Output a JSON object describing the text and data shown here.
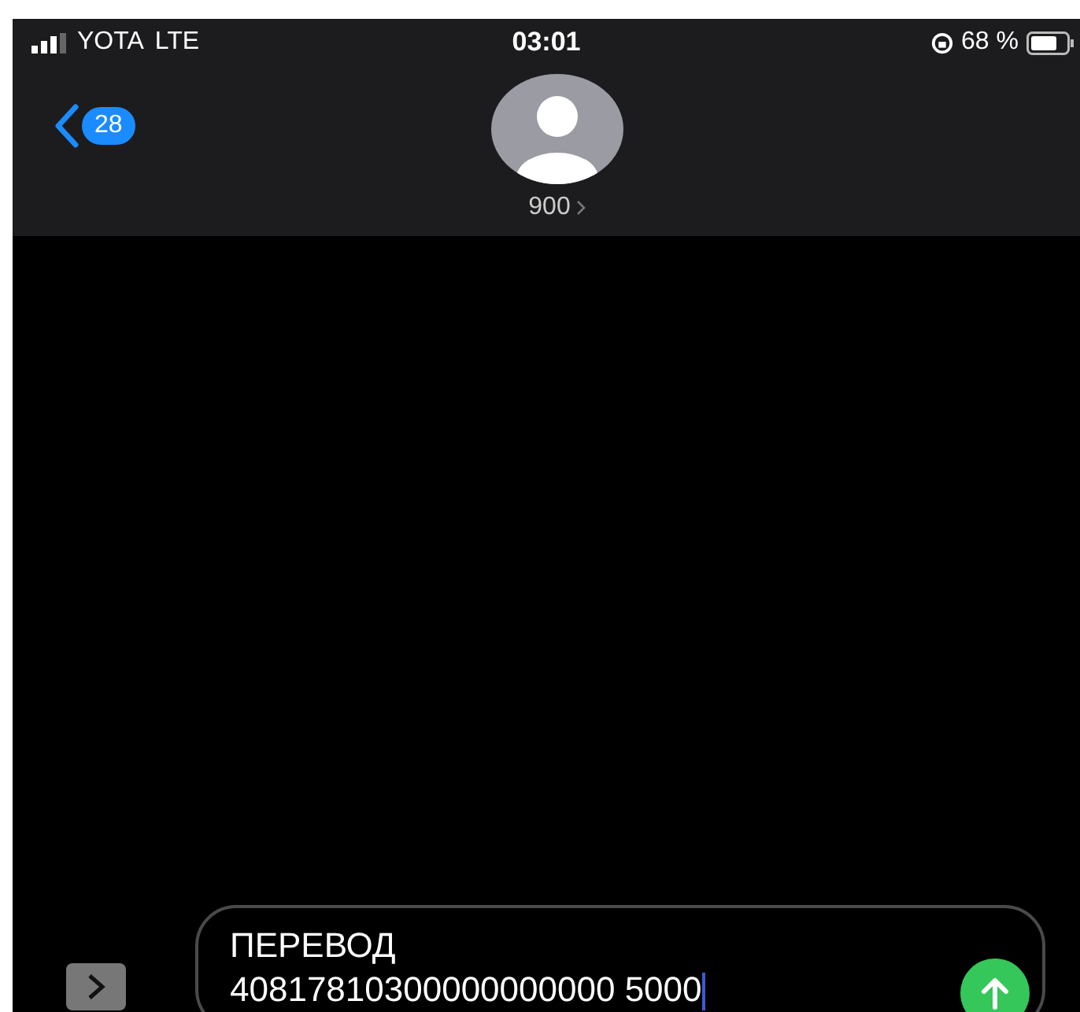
{
  "status_bar": {
    "carrier": "YOTA",
    "network": "LTE",
    "time": "03:01",
    "battery": "68 %"
  },
  "header": {
    "back_badge": "28",
    "contact": "900"
  },
  "composer": {
    "message_lines": [
      "ПЕРЕВОД",
      "40817810300000000000 5000"
    ]
  }
}
